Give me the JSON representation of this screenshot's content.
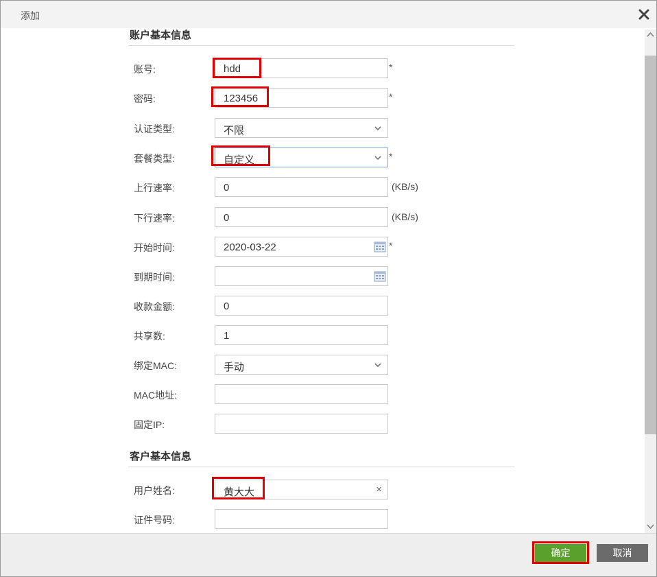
{
  "dialog": {
    "title": "添加",
    "close_symbol": "✕"
  },
  "sections": {
    "account": "账户基本信息",
    "customer": "客户基本信息"
  },
  "form": {
    "account": {
      "label": "账号:",
      "value": "hdd",
      "required": "*"
    },
    "password": {
      "label": "密码:",
      "value": "123456",
      "required": "*"
    },
    "auth_type": {
      "label": "认证类型:",
      "value": "不限"
    },
    "package_type": {
      "label": "套餐类型:",
      "value": "自定义",
      "required": "*"
    },
    "upload_rate": {
      "label": "上行速率:",
      "value": "0",
      "unit": "(KB/s)"
    },
    "download_rate": {
      "label": "下行速率:",
      "value": "0",
      "unit": "(KB/s)"
    },
    "start_time": {
      "label": "开始时间:",
      "value": "2020-03-22",
      "required": "*"
    },
    "expire_time": {
      "label": "到期时间:",
      "value": ""
    },
    "amount": {
      "label": "收款金额:",
      "value": "0"
    },
    "share_count": {
      "label": "共享数:",
      "value": "1"
    },
    "bind_mac": {
      "label": "绑定MAC:",
      "value": "手动"
    },
    "mac_address": {
      "label": "MAC地址:",
      "value": ""
    },
    "fixed_ip": {
      "label": "固定IP:",
      "value": ""
    },
    "user_name": {
      "label": "用户姓名:",
      "value": "黄大大",
      "clear_symbol": "×"
    },
    "id_number": {
      "label": "证件号码:",
      "value": ""
    }
  },
  "footer": {
    "ok_label": "确定",
    "cancel_label": "取消"
  },
  "icons": [
    "close-icon",
    "chevron-down-icon",
    "calendar-icon",
    "clear-icon",
    "scroll-up-icon",
    "scroll-down-icon"
  ],
  "colors": {
    "highlight": "#e00000",
    "ok_button": "#5aa02c",
    "cancel_button": "#6b6b6b"
  }
}
